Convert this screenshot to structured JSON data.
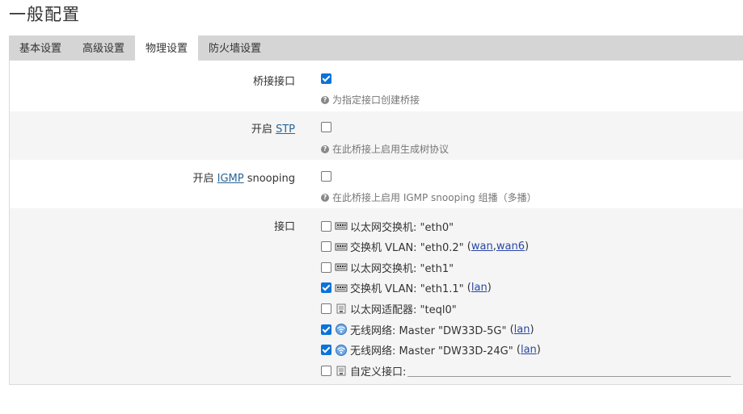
{
  "page": {
    "title": "一般配置"
  },
  "tabs": [
    {
      "label": "基本设置",
      "active": false
    },
    {
      "label": "高级设置",
      "active": false
    },
    {
      "label": "物理设置",
      "active": true
    },
    {
      "label": "防火墙设置",
      "active": false
    }
  ],
  "bridge": {
    "label": "桥接接口",
    "checked": true,
    "help": "为指定接口创建桥接"
  },
  "stp": {
    "label_prefix": "开启 ",
    "link": "STP",
    "checked": false,
    "help": "在此桥接上启用生成树协议"
  },
  "igmp": {
    "label_prefix": "开启 ",
    "link": "IGMP",
    "label_suffix": " snooping",
    "checked": false,
    "help": "在此桥接上启用 IGMP snooping 组播（多播）"
  },
  "interfaces": {
    "label": "接口",
    "items": [
      {
        "icon": "switch-icon",
        "text": "以太网交换机: \"eth0\"",
        "checked": false,
        "zones": []
      },
      {
        "icon": "switch-icon",
        "text": "交换机 VLAN: \"eth0.2\"",
        "checked": false,
        "zones": [
          "wan",
          "wan6"
        ]
      },
      {
        "icon": "switch-icon",
        "text": "以太网交换机: \"eth1\"",
        "checked": false,
        "zones": []
      },
      {
        "icon": "switch-icon",
        "text": "交换机 VLAN: \"eth1.1\"",
        "checked": true,
        "zones": [
          "lan"
        ]
      },
      {
        "icon": "ethernet-icon",
        "text": "以太网适配器: \"teql0\"",
        "checked": false,
        "zones": []
      },
      {
        "icon": "wifi-icon",
        "text": "无线网络: Master \"DW33D-5G\"",
        "checked": true,
        "zones": [
          "lan"
        ]
      },
      {
        "icon": "wifi-icon",
        "text": "无线网络: Master \"DW33D-24G\"",
        "checked": true,
        "zones": [
          "lan"
        ]
      }
    ],
    "custom": {
      "label": "自定义接口:",
      "value": "",
      "checked": false
    }
  },
  "colors": {
    "accent": "#0b73d9",
    "tab_bar": "#d5d5d5",
    "row_alt": "#f5f5f5",
    "link": "#2a47a6"
  }
}
